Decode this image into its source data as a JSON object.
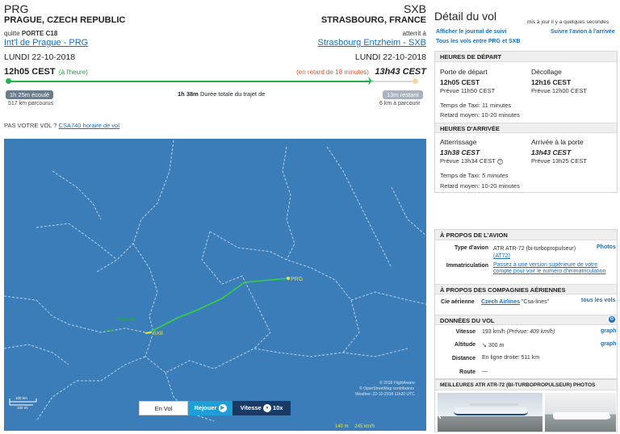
{
  "origin": {
    "code": "PRG",
    "city": "PRAGUE, CZECH REPUBLIC",
    "gate_label": "quitte",
    "gate": "PORTE C18",
    "airport": "Int'l de Prague - PRG",
    "date": "LUNDI 22-10-2018",
    "time": "12h05 CEST",
    "status": "(à l'heure)"
  },
  "destination": {
    "code": "SXB",
    "city": "STRASBOURG, FRANCE",
    "arrive_label": "atterrit à",
    "airport": "Strasbourg Entzheim - SXB",
    "date": "LUNDI 22-10-2018",
    "delay": "(en retard de 18 minutes)",
    "time": "13h43 CEST"
  },
  "progress": {
    "fraction": 0.89,
    "elapsed": "1h 25m écoulé",
    "elapsed_km": "517 km parcourus",
    "total": "1h 38m",
    "total_label": "Durée totale du trajet de",
    "remaining": "13m restant",
    "remaining_km": "6 km à parcourir"
  },
  "not_your_flight": {
    "text": "PAS VOTRE VOL ?",
    "link": "CSA740 horaire de vol"
  },
  "map": {
    "labels": {
      "prg": "PRG",
      "sxb": "SXB",
      "csa": "CSA740",
      "csa2": "SXB"
    },
    "attribution": [
      "© 2018 FlightAware",
      "© OpenStreetMap contributors",
      "Weather: 22-10-2018 11h20 UTC"
    ],
    "scale_km": "100 km",
    "scale_mi": "100 mi",
    "controls": {
      "en_vol": "En Vol",
      "rejouer": "Rejouer",
      "vitesse": "Vitesse",
      "speed": "10x"
    },
    "bottom_stats": [
      "140 m",
      "245 km/h"
    ]
  },
  "detail": {
    "title": "Détail du vol",
    "updated": "mis à jour il y a quelques secondes",
    "journal_link": "Afficher le journal de suivi",
    "follow_link": "Suivre l'avion à l'arrivée",
    "all_flights_link": "Tous les vols entre PRG et SXB"
  },
  "departure": {
    "header": "HEURES DE DÉPART",
    "gate_label": "Porte de départ",
    "gate_time": "12h05 CEST",
    "gate_planned": "Prévue 11h50 CEST",
    "takeoff_label": "Décollage",
    "takeoff_time": "12h16 CEST",
    "takeoff_planned": "Prévue 12h00 CEST",
    "taxi_label": "Temps de Taxi:",
    "taxi_value": "11 minutes",
    "delay_label": "Retard moyen:",
    "delay_value": "10-20 minutes"
  },
  "arrival": {
    "header": "HEURES D'ARRIVÉE",
    "landing_label": "Atterrissage",
    "landing_time": "13h38 CEST",
    "landing_planned": "Prévue 13h34 CEST",
    "gate_label": "Arrivée à la porte",
    "gate_time": "13h43 CEST",
    "gate_planned": "Prévue 13h25 CEST",
    "taxi_label": "Temps de Taxi:",
    "taxi_value": "5 minutes",
    "delay_label": "Retard moyen:",
    "delay_value": "10-20 minutes"
  },
  "aircraft": {
    "header": "À PROPOS DE L'AVION",
    "type_label": "Type d'avion",
    "type_value": "ATR ATR-72 (bi-turbopropulseur)",
    "type_code": "(AT72)",
    "photos_link": "Photos",
    "reg_label": "Immatriculation",
    "reg_value": "Passez à une version supérieure de votre compte pour voir le numéro d'immatriculation"
  },
  "airline": {
    "header": "À PROPOS DES COMPAGNIES AÉRIENNES",
    "label": "Cie aérienne",
    "name": "Czech Airlines",
    "callsign": "\"Csa-lines\"",
    "all_link": "tous les vols"
  },
  "flight_data": {
    "header": "DONNÉES DU VOL",
    "speed_label": "Vitesse",
    "speed_value": "193 km/h",
    "speed_planned": "(Prévue: 409 km/h)",
    "graph1": "graph",
    "alt_label": "Altitude",
    "alt_value": "300 m",
    "graph2": "graph",
    "dist_label": "Distance",
    "dist_value": "En ligne droite: 511 km",
    "route_label": "Route",
    "route_value": "—"
  },
  "photos": {
    "header": "MEILLEURES ATR ATR-72 (BI-TURBOPROPULSEUR) PHOTOS"
  },
  "colors": {
    "accent_blue": "#1a6fb8",
    "route_green": "#22b14c",
    "map_blue": "#3b7db9",
    "delay_red": "#e2532b"
  }
}
